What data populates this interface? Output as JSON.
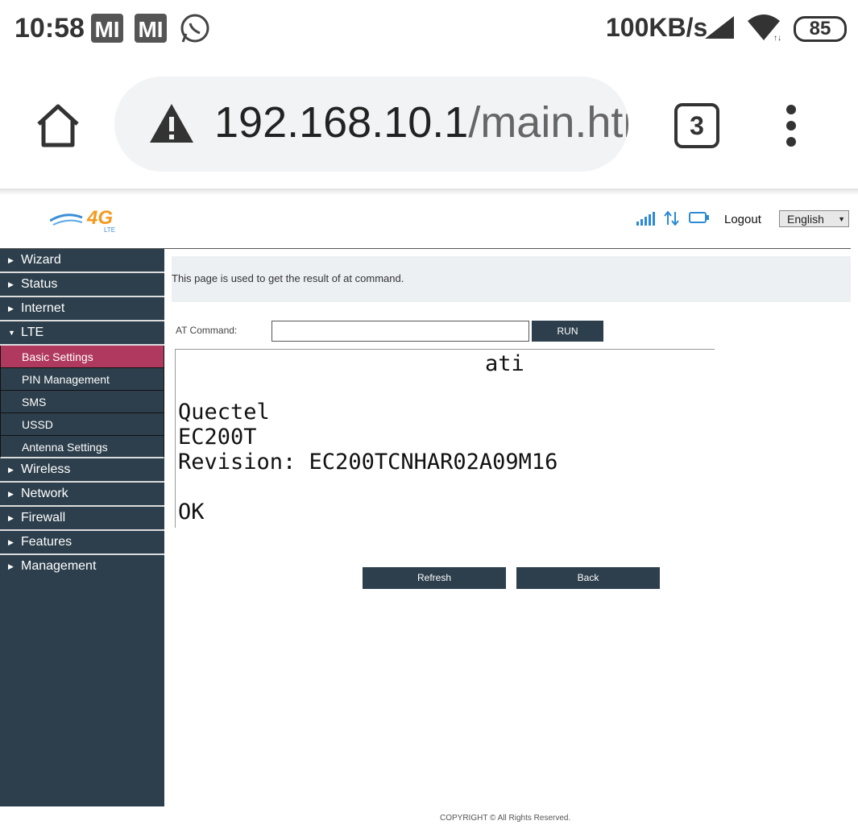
{
  "status_bar": {
    "time": "10:58",
    "speed": "100KB/s",
    "battery": "85"
  },
  "browser": {
    "url_host": "192.168.10.1",
    "url_path": "/main.htm",
    "tab_count": "3"
  },
  "header": {
    "logo_text": "4G",
    "logo_sub": "LTE",
    "logout_label": "Logout",
    "language": "English"
  },
  "sidebar": {
    "items_top": [
      {
        "label": "Wizard"
      },
      {
        "label": "Status"
      },
      {
        "label": "Internet"
      },
      {
        "label": "LTE"
      }
    ],
    "sub_items": [
      {
        "label": "Basic Settings"
      },
      {
        "label": "PIN Management"
      },
      {
        "label": "SMS"
      },
      {
        "label": "USSD"
      },
      {
        "label": "Antenna Settings"
      }
    ],
    "items_bottom": [
      {
        "label": "Wireless"
      },
      {
        "label": "Network"
      },
      {
        "label": "Firewall"
      },
      {
        "label": "Features"
      },
      {
        "label": "Management"
      }
    ]
  },
  "main": {
    "info_text": "This page is used to get the result of at command.",
    "at_label": "AT Command:",
    "at_value": "",
    "run_label": "RUN",
    "result": {
      "command": "ati",
      "lines": [
        "Quectel",
        "EC200T",
        "Revision: EC200TCNHAR02A09M16",
        "",
        "OK"
      ]
    },
    "refresh_label": "Refresh",
    "back_label": "Back"
  },
  "footer": {
    "copyright": "COPYRIGHT © All Rights Reserved."
  },
  "colors": {
    "sidebar_bg": "#2d3f4c",
    "active_item": "#b0395f",
    "info_bg": "#edf0f3"
  }
}
